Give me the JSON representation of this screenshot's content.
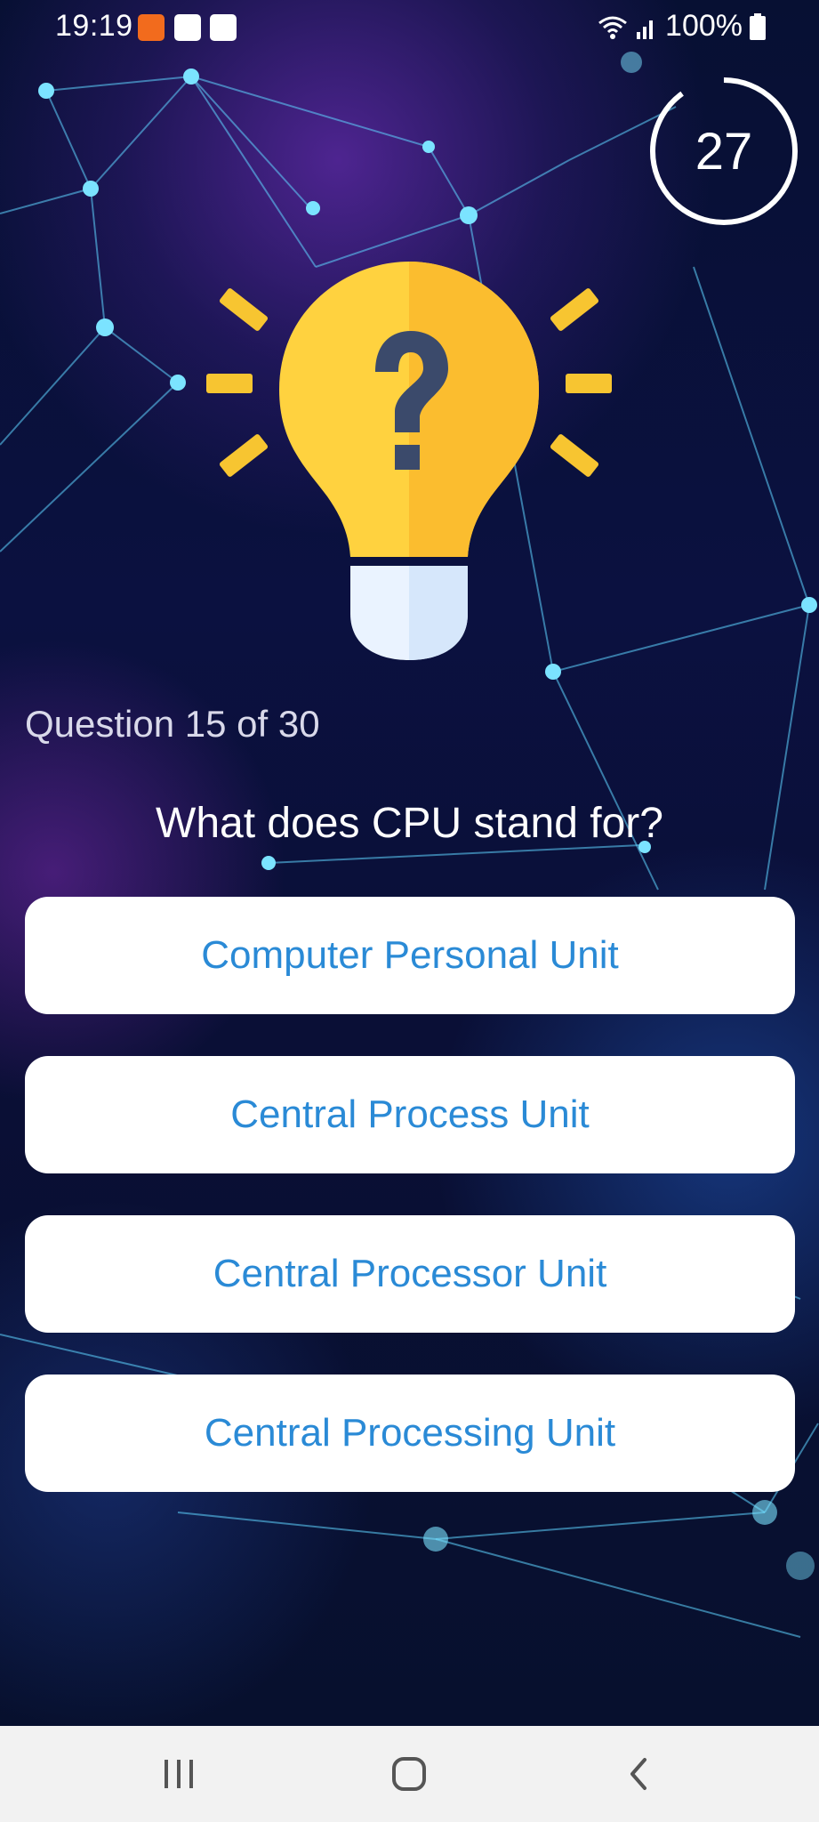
{
  "status_bar": {
    "time": "19:19",
    "battery": "100%",
    "icons": [
      "app-notification-icon",
      "image-icon",
      "media-icon",
      "wifi-icon",
      "signal-icon",
      "battery-icon"
    ]
  },
  "timer": {
    "seconds": "27",
    "remaining_fraction": 0.9
  },
  "quiz": {
    "counter": "Question 15 of 30",
    "question": "What does CPU stand for?",
    "answers": [
      "Computer Personal Unit",
      "Central Process Unit",
      "Central Processor Unit",
      "Central Processing Unit"
    ]
  },
  "colors": {
    "accent_text": "#2a8ad6",
    "bulb_yellow": "#ffd23f",
    "question_mark": "#3b4a6b"
  },
  "nav_bar": {
    "buttons": [
      "recent-apps-icon",
      "home-icon",
      "back-icon"
    ]
  }
}
